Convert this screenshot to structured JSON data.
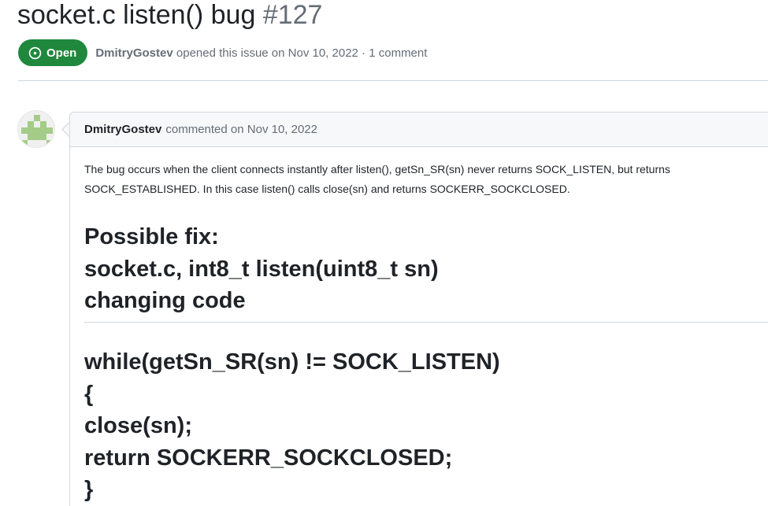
{
  "issue": {
    "title": "socket.c listen() bug",
    "number": "#127",
    "state_label": "Open",
    "author": "DmitryGostev",
    "meta_suffix": "opened this issue on Nov 10, 2022 · 1 comment"
  },
  "comment": {
    "author": "DmitryGostev",
    "meta": "commented on Nov 10, 2022",
    "body_lines": [
      "The bug occurs when the client connects instantly after listen(), getSn_SR(sn) never returns SOCK_LISTEN, but returns",
      "SOCK_ESTABLISHED. In this case listen() calls close(sn) and returns SOCKERR_SOCKCLOSED."
    ],
    "fix_heading_lines": [
      "Possible fix:",
      "socket.c, int8_t listen(uint8_t sn)",
      "changing code"
    ],
    "code_lines": [
      "while(getSn_SR(sn) != SOCK_LISTEN)",
      "{",
      "close(sn);",
      "return SOCKERR_SOCKCLOSED;",
      "}"
    ]
  },
  "colors": {
    "open_badge": "#1f883d",
    "muted_text": "#656d76",
    "border": "#d0d7de",
    "header_bg": "#f6f8fa"
  },
  "icons": {
    "state": "issue-opened-icon",
    "avatar": "identicon-avatar"
  }
}
